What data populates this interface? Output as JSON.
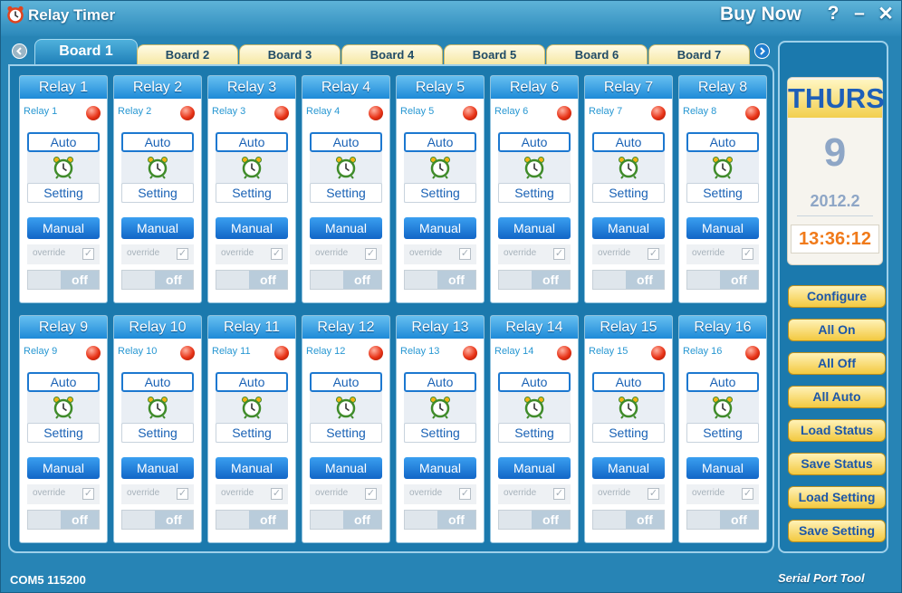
{
  "app": {
    "title": "Relay Timer",
    "buy_now": "Buy Now",
    "help": "?",
    "minimize": "–",
    "close": "✕"
  },
  "tabs": [
    "Board 1",
    "Board 2",
    "Board 3",
    "Board 4",
    "Board 5",
    "Board 6",
    "Board 7"
  ],
  "active_tab": "Board 1",
  "relay_labels": {
    "auto": "Auto",
    "setting": "Setting",
    "manual": "Manual",
    "override": "override",
    "toggle_off": "off",
    "check_mark": "✓"
  },
  "relays": [
    {
      "header": "Relay 1",
      "name": "Relay 1"
    },
    {
      "header": "Relay 2",
      "name": "Relay 2"
    },
    {
      "header": "Relay 3",
      "name": "Relay 3"
    },
    {
      "header": "Relay 4",
      "name": "Relay 4"
    },
    {
      "header": "Relay 5",
      "name": "Relay 5"
    },
    {
      "header": "Relay 6",
      "name": "Relay 6"
    },
    {
      "header": "Relay 7",
      "name": "Relay 7"
    },
    {
      "header": "Relay 8",
      "name": "Relay 8"
    },
    {
      "header": "Relay 9",
      "name": "Relay 9"
    },
    {
      "header": "Relay 10",
      "name": "Relay 10"
    },
    {
      "header": "Relay 11",
      "name": "Relay 11"
    },
    {
      "header": "Relay 12",
      "name": "Relay 12"
    },
    {
      "header": "Relay 13",
      "name": "Relay 13"
    },
    {
      "header": "Relay 14",
      "name": "Relay 14"
    },
    {
      "header": "Relay 15",
      "name": "Relay 15"
    },
    {
      "header": "Relay 16",
      "name": "Relay 16"
    }
  ],
  "date_panel": {
    "day": "THURS",
    "day_number": "9",
    "year_month": "2012.2",
    "time": "13:36:12"
  },
  "side_buttons": [
    "Configure",
    "All On",
    "All Off",
    "All Auto",
    "Load Status",
    "Save Status",
    "Load Setting",
    "Save Setting"
  ],
  "status_bar": {
    "port": "COM5 115200",
    "brand": "Serial Port Tool"
  },
  "colors": {
    "window_blue": "#2784b5",
    "panel_blue": "#1b79ad",
    "relay_header": "#1e8ad8",
    "led_red": "#e83418",
    "side_button_gold": "#f3c940",
    "time_orange": "#f07a1a"
  }
}
